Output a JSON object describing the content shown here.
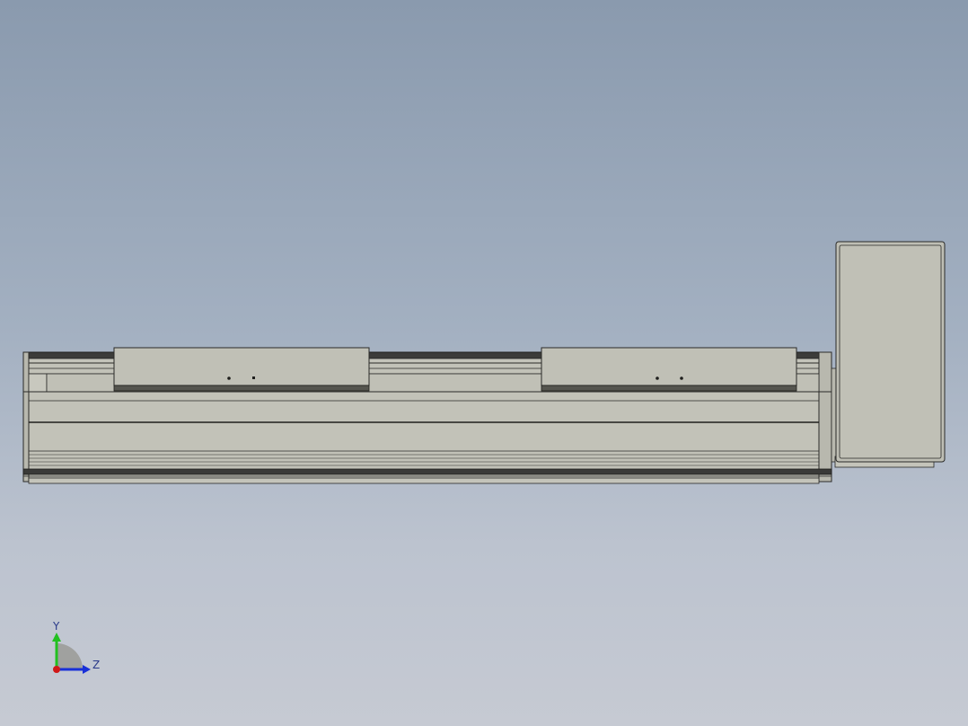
{
  "viewport": {
    "background_top": "#8a9aae",
    "background_bottom": "#c6cad3"
  },
  "model": {
    "body_color": "#c0c0b6",
    "edge_color": "#2a2a28",
    "rail_color": "#3a3a38",
    "shadow_color": "#6e6e66"
  },
  "triad": {
    "y_label": "Y",
    "z_label": "Z",
    "y_color": "#22c020",
    "z_color": "#1830d8",
    "x_color": "#d01818"
  }
}
